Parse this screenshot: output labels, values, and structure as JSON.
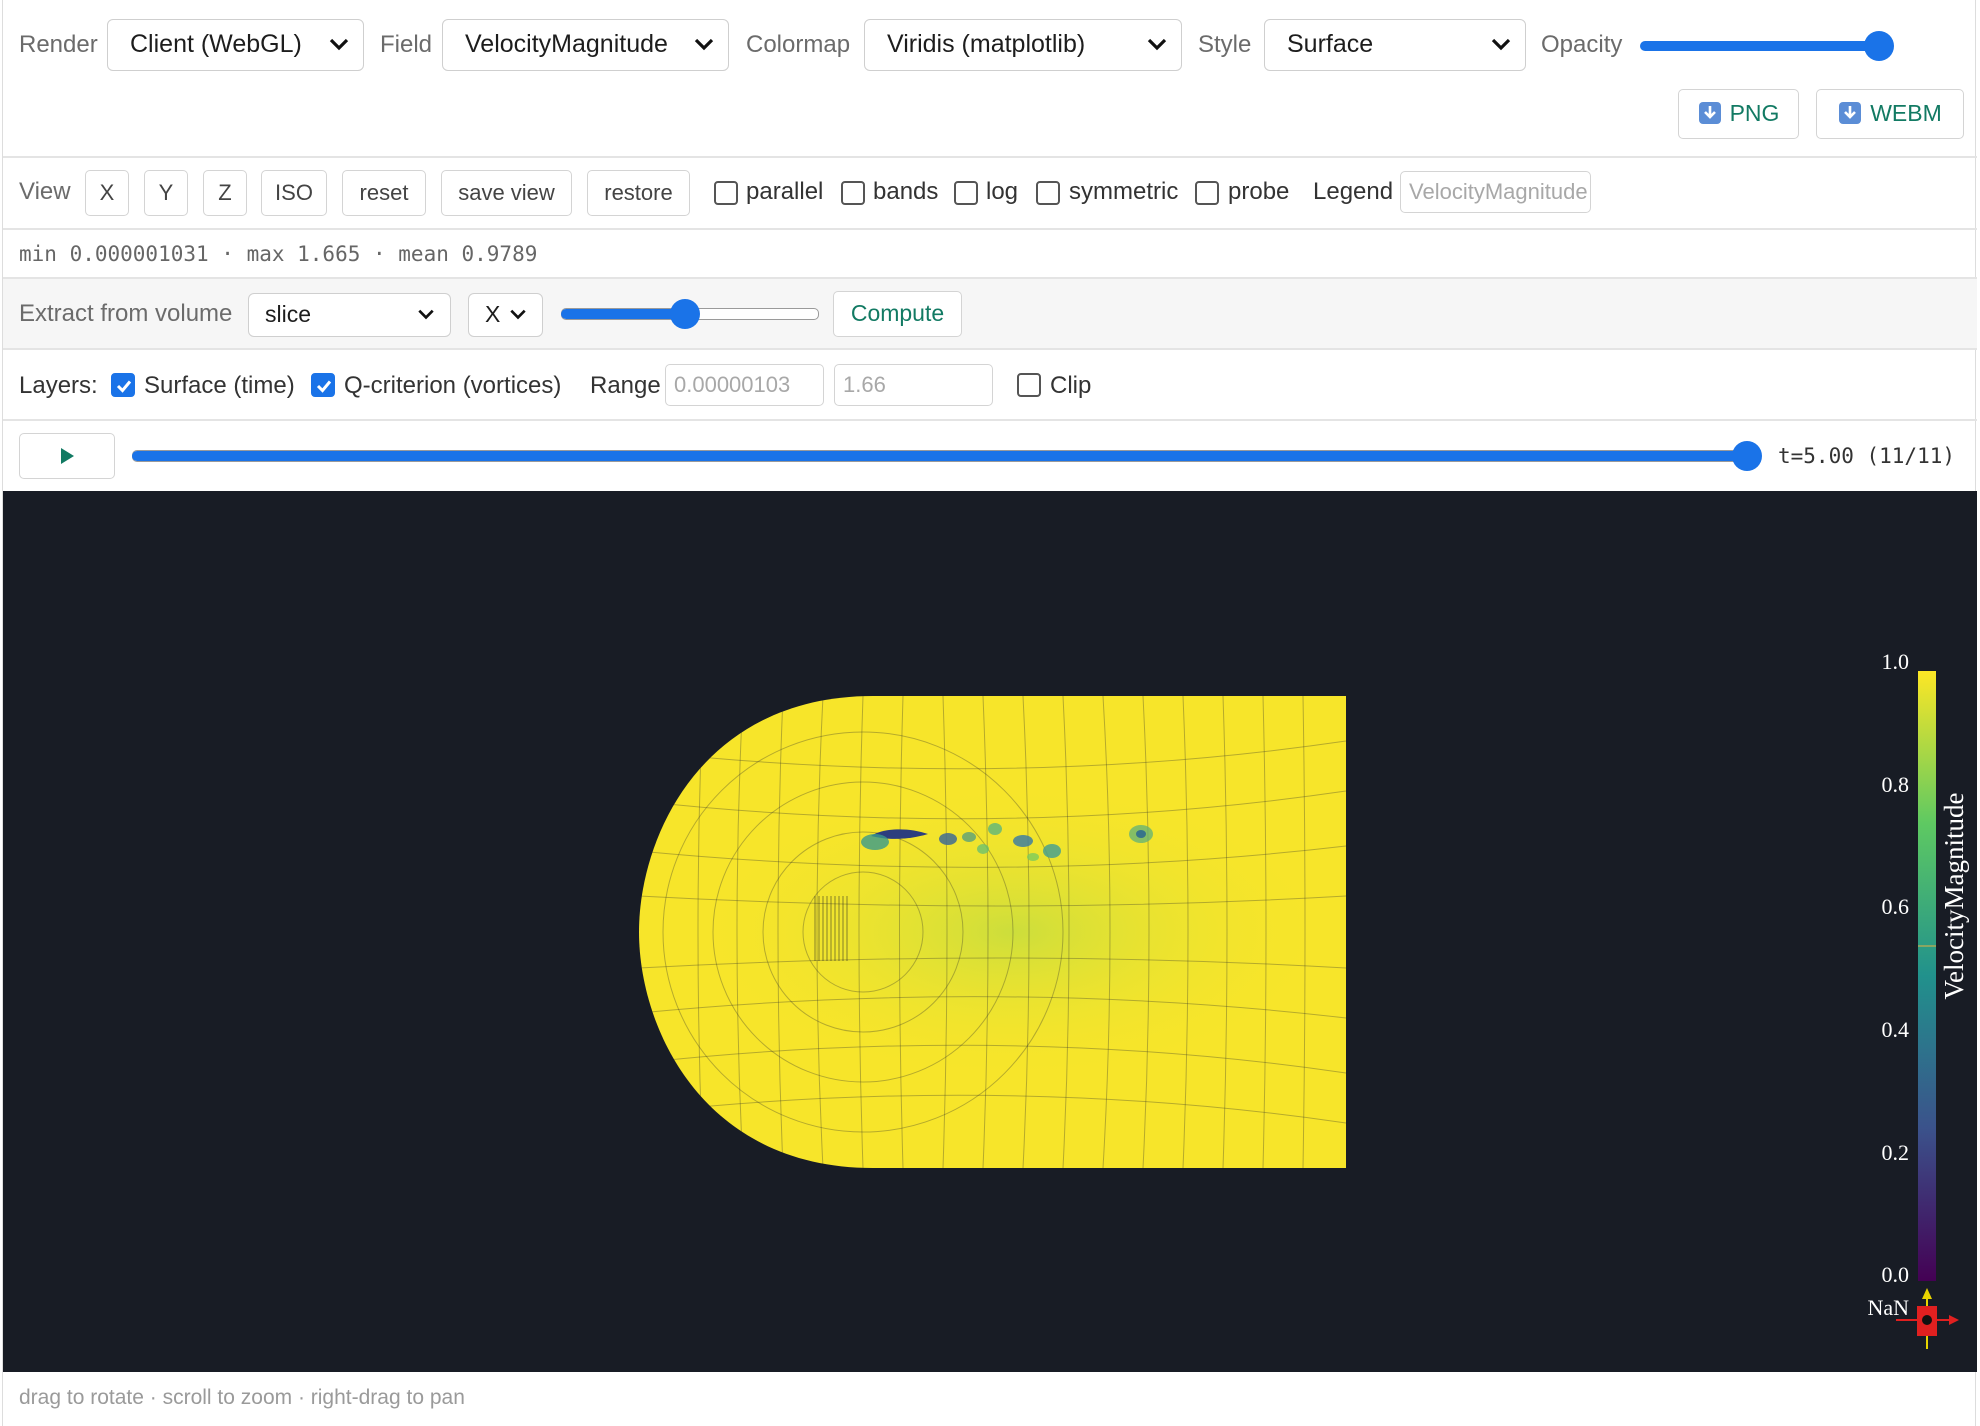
{
  "toolbar": {
    "render": {
      "label": "Render",
      "value": "Client (WebGL)"
    },
    "field": {
      "label": "Field",
      "value": "VelocityMagnitude"
    },
    "colormap": {
      "label": "Colormap",
      "value": "Viridis (matplotlib)"
    },
    "style": {
      "label": "Style",
      "value": "Surface"
    },
    "opacity": {
      "label": "Opacity",
      "value": 1.0
    },
    "png_label": "PNG",
    "webm_label": "WEBM"
  },
  "view_bar": {
    "label": "View",
    "buttons": [
      "X",
      "Y",
      "Z",
      "ISO",
      "reset",
      "save view",
      "restore"
    ],
    "checkboxes": [
      {
        "label": "parallel",
        "checked": false
      },
      {
        "label": "bands",
        "checked": false
      },
      {
        "label": "log",
        "checked": false
      },
      {
        "label": "symmetric",
        "checked": false
      },
      {
        "label": "probe",
        "checked": false
      }
    ],
    "legend_label": "Legend",
    "legend_placeholder": "VelocityMagnitude"
  },
  "stats": {
    "text": "min 0.000001031 · max 1.665 · mean 0.9789"
  },
  "extract": {
    "label": "Extract from volume",
    "mode": "slice",
    "axis": "X",
    "position": 0.48,
    "compute_label": "Compute"
  },
  "layers": {
    "label": "Layers:",
    "items": [
      {
        "label": "Surface (time)",
        "checked": true
      },
      {
        "label": "Q-criterion (vortices)",
        "checked": true
      }
    ],
    "range_label": "Range",
    "range_min": "0.00000103",
    "range_max": "1.66",
    "clip_label": "Clip",
    "clip_checked": false
  },
  "timeline": {
    "play_icon": "play-icon",
    "time_text": "t=5.00 (11/11)",
    "progress": 1.0
  },
  "scalar_bar": {
    "title": "VelocityMagnitude",
    "ticks": [
      "1.0",
      "0.8",
      "0.6",
      "0.4",
      "0.2",
      "0.0"
    ],
    "nan_label": "NaN",
    "colors": [
      "#440154",
      "#3b528b",
      "#21918c",
      "#5ec962",
      "#fde725"
    ]
  },
  "colors": {
    "accent": "#1a73e8",
    "action_text": "#127a63",
    "viewport_bg": "#181c25",
    "mesh_fill": "#f7e52a"
  },
  "footer": {
    "hint": "drag to rotate · scroll to zoom · right-drag to pan"
  }
}
